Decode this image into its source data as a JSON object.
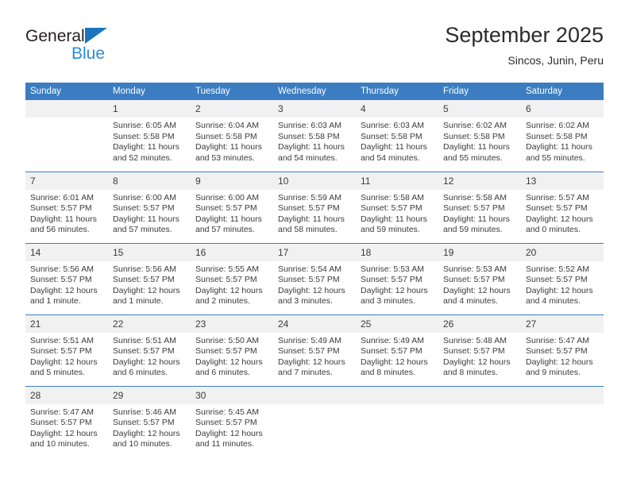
{
  "brand": {
    "line1": "General",
    "line2": "Blue",
    "triangle_color": "#1b75bc",
    "line2_color": "#2b8ad6"
  },
  "header": {
    "title": "September 2025",
    "subtitle": "Sincos, Junin, Peru"
  },
  "theme": {
    "header_row_bg": "#3b7dc0",
    "daynum_bg": "#f1f1f1",
    "text_color": "#3b3b3b"
  },
  "columns": [
    "Sunday",
    "Monday",
    "Tuesday",
    "Wednesday",
    "Thursday",
    "Friday",
    "Saturday"
  ],
  "weeks": [
    [
      {
        "day": "",
        "empty": true,
        "lines": []
      },
      {
        "day": "1",
        "lines": [
          "Sunrise: 6:05 AM",
          "Sunset: 5:58 PM",
          "Daylight: 11 hours",
          "and 52 minutes."
        ]
      },
      {
        "day": "2",
        "lines": [
          "Sunrise: 6:04 AM",
          "Sunset: 5:58 PM",
          "Daylight: 11 hours",
          "and 53 minutes."
        ]
      },
      {
        "day": "3",
        "lines": [
          "Sunrise: 6:03 AM",
          "Sunset: 5:58 PM",
          "Daylight: 11 hours",
          "and 54 minutes."
        ]
      },
      {
        "day": "4",
        "lines": [
          "Sunrise: 6:03 AM",
          "Sunset: 5:58 PM",
          "Daylight: 11 hours",
          "and 54 minutes."
        ]
      },
      {
        "day": "5",
        "lines": [
          "Sunrise: 6:02 AM",
          "Sunset: 5:58 PM",
          "Daylight: 11 hours",
          "and 55 minutes."
        ]
      },
      {
        "day": "6",
        "lines": [
          "Sunrise: 6:02 AM",
          "Sunset: 5:58 PM",
          "Daylight: 11 hours",
          "and 55 minutes."
        ]
      }
    ],
    [
      {
        "day": "7",
        "lines": [
          "Sunrise: 6:01 AM",
          "Sunset: 5:57 PM",
          "Daylight: 11 hours",
          "and 56 minutes."
        ]
      },
      {
        "day": "8",
        "lines": [
          "Sunrise: 6:00 AM",
          "Sunset: 5:57 PM",
          "Daylight: 11 hours",
          "and 57 minutes."
        ]
      },
      {
        "day": "9",
        "lines": [
          "Sunrise: 6:00 AM",
          "Sunset: 5:57 PM",
          "Daylight: 11 hours",
          "and 57 minutes."
        ]
      },
      {
        "day": "10",
        "lines": [
          "Sunrise: 5:59 AM",
          "Sunset: 5:57 PM",
          "Daylight: 11 hours",
          "and 58 minutes."
        ]
      },
      {
        "day": "11",
        "lines": [
          "Sunrise: 5:58 AM",
          "Sunset: 5:57 PM",
          "Daylight: 11 hours",
          "and 59 minutes."
        ]
      },
      {
        "day": "12",
        "lines": [
          "Sunrise: 5:58 AM",
          "Sunset: 5:57 PM",
          "Daylight: 11 hours",
          "and 59 minutes."
        ]
      },
      {
        "day": "13",
        "lines": [
          "Sunrise: 5:57 AM",
          "Sunset: 5:57 PM",
          "Daylight: 12 hours",
          "and 0 minutes."
        ]
      }
    ],
    [
      {
        "day": "14",
        "lines": [
          "Sunrise: 5:56 AM",
          "Sunset: 5:57 PM",
          "Daylight: 12 hours",
          "and 1 minute."
        ]
      },
      {
        "day": "15",
        "lines": [
          "Sunrise: 5:56 AM",
          "Sunset: 5:57 PM",
          "Daylight: 12 hours",
          "and 1 minute."
        ]
      },
      {
        "day": "16",
        "lines": [
          "Sunrise: 5:55 AM",
          "Sunset: 5:57 PM",
          "Daylight: 12 hours",
          "and 2 minutes."
        ]
      },
      {
        "day": "17",
        "lines": [
          "Sunrise: 5:54 AM",
          "Sunset: 5:57 PM",
          "Daylight: 12 hours",
          "and 3 minutes."
        ]
      },
      {
        "day": "18",
        "lines": [
          "Sunrise: 5:53 AM",
          "Sunset: 5:57 PM",
          "Daylight: 12 hours",
          "and 3 minutes."
        ]
      },
      {
        "day": "19",
        "lines": [
          "Sunrise: 5:53 AM",
          "Sunset: 5:57 PM",
          "Daylight: 12 hours",
          "and 4 minutes."
        ]
      },
      {
        "day": "20",
        "lines": [
          "Sunrise: 5:52 AM",
          "Sunset: 5:57 PM",
          "Daylight: 12 hours",
          "and 4 minutes."
        ]
      }
    ],
    [
      {
        "day": "21",
        "lines": [
          "Sunrise: 5:51 AM",
          "Sunset: 5:57 PM",
          "Daylight: 12 hours",
          "and 5 minutes."
        ]
      },
      {
        "day": "22",
        "lines": [
          "Sunrise: 5:51 AM",
          "Sunset: 5:57 PM",
          "Daylight: 12 hours",
          "and 6 minutes."
        ]
      },
      {
        "day": "23",
        "lines": [
          "Sunrise: 5:50 AM",
          "Sunset: 5:57 PM",
          "Daylight: 12 hours",
          "and 6 minutes."
        ]
      },
      {
        "day": "24",
        "lines": [
          "Sunrise: 5:49 AM",
          "Sunset: 5:57 PM",
          "Daylight: 12 hours",
          "and 7 minutes."
        ]
      },
      {
        "day": "25",
        "lines": [
          "Sunrise: 5:49 AM",
          "Sunset: 5:57 PM",
          "Daylight: 12 hours",
          "and 8 minutes."
        ]
      },
      {
        "day": "26",
        "lines": [
          "Sunrise: 5:48 AM",
          "Sunset: 5:57 PM",
          "Daylight: 12 hours",
          "and 8 minutes."
        ]
      },
      {
        "day": "27",
        "lines": [
          "Sunrise: 5:47 AM",
          "Sunset: 5:57 PM",
          "Daylight: 12 hours",
          "and 9 minutes."
        ]
      }
    ],
    [
      {
        "day": "28",
        "lines": [
          "Sunrise: 5:47 AM",
          "Sunset: 5:57 PM",
          "Daylight: 12 hours",
          "and 10 minutes."
        ]
      },
      {
        "day": "29",
        "lines": [
          "Sunrise: 5:46 AM",
          "Sunset: 5:57 PM",
          "Daylight: 12 hours",
          "and 10 minutes."
        ]
      },
      {
        "day": "30",
        "lines": [
          "Sunrise: 5:45 AM",
          "Sunset: 5:57 PM",
          "Daylight: 12 hours",
          "and 11 minutes."
        ]
      },
      {
        "day": "",
        "empty": true,
        "lines": []
      },
      {
        "day": "",
        "empty": true,
        "lines": []
      },
      {
        "day": "",
        "empty": true,
        "lines": []
      },
      {
        "day": "",
        "empty": true,
        "lines": []
      }
    ]
  ]
}
